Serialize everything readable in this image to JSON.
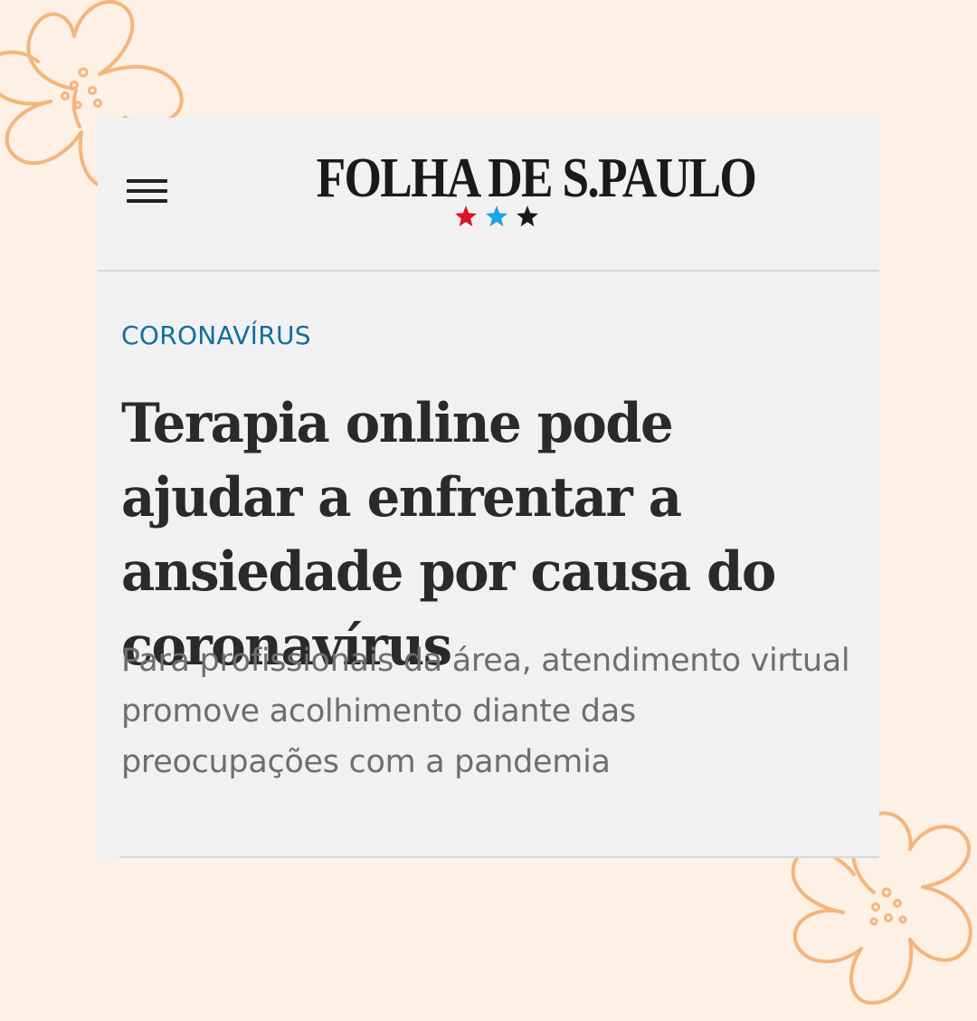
{
  "header": {
    "menu_icon": "hamburger-menu-icon",
    "logo_text": "FOLHA DE S.PAULO",
    "stars": [
      {
        "icon": "star-icon",
        "color": "#d7132a"
      },
      {
        "icon": "star-icon",
        "color": "#18a6de"
      },
      {
        "icon": "star-icon",
        "color": "#1a1a1a"
      }
    ]
  },
  "article": {
    "kicker": "CORONAVÍRUS",
    "kicker_color": "#106ea0",
    "headline": "Terapia online pode ajudar a enfrentar a ansiedade por causa do coronavírus",
    "deck": "Para profissionais da área, atendimento virtual promove acolhimento diante das preocupações com a pandemia"
  },
  "decorations": {
    "background_color": "#fdf0e4",
    "flower_color": "#f5b57a",
    "flower_icon": "flower-outline-icon"
  }
}
